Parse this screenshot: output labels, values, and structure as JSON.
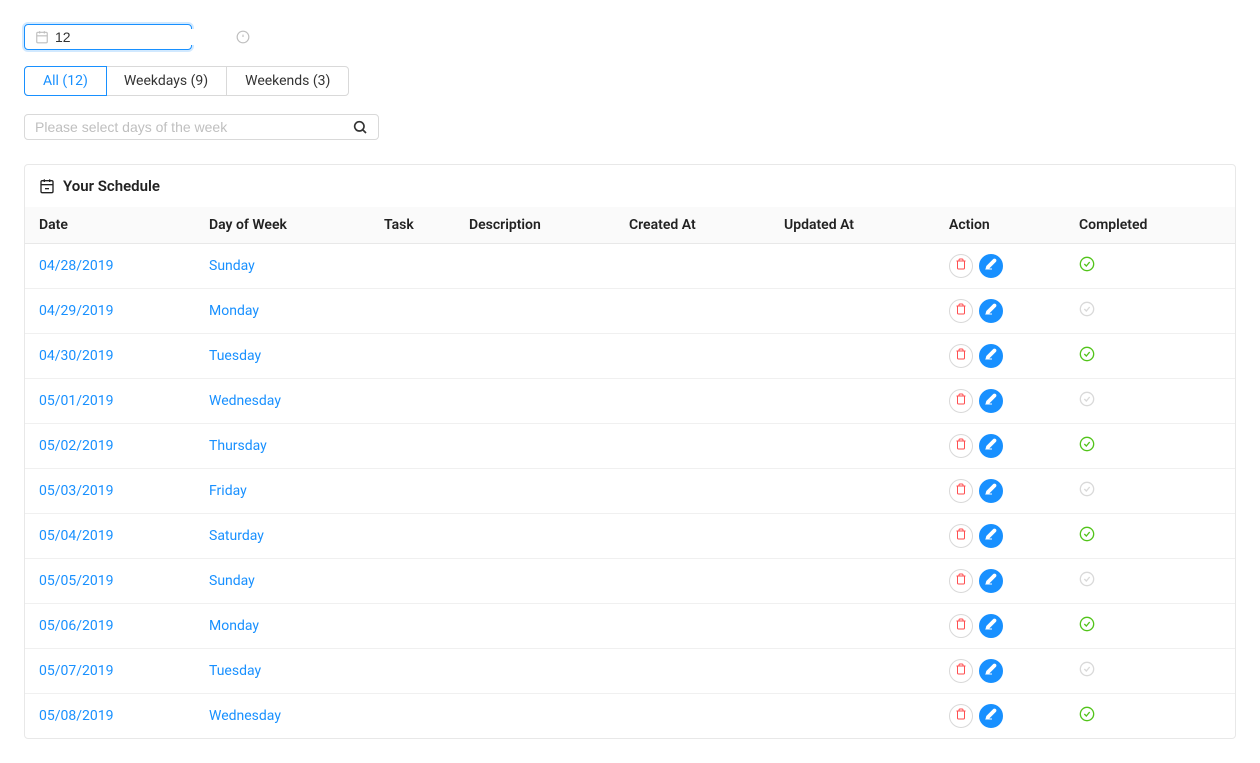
{
  "dateInput": {
    "value": "12"
  },
  "tabs": [
    {
      "label": "All (12)",
      "active": true
    },
    {
      "label": "Weekdays (9)",
      "active": false
    },
    {
      "label": "Weekends (3)",
      "active": false
    }
  ],
  "search": {
    "placeholder": "Please select days of the week",
    "value": ""
  },
  "panel": {
    "title": "Your Schedule"
  },
  "columns": {
    "date": "Date",
    "dow": "Day of Week",
    "task": "Task",
    "desc": "Description",
    "created": "Created At",
    "updated": "Updated At",
    "action": "Action",
    "completed": "Completed"
  },
  "rows": [
    {
      "date": "04/28/2019",
      "dow": "Sunday",
      "task": "",
      "desc": "",
      "created": "",
      "updated": "",
      "completed": true
    },
    {
      "date": "04/29/2019",
      "dow": "Monday",
      "task": "",
      "desc": "",
      "created": "",
      "updated": "",
      "completed": false
    },
    {
      "date": "04/30/2019",
      "dow": "Tuesday",
      "task": "",
      "desc": "",
      "created": "",
      "updated": "",
      "completed": true
    },
    {
      "date": "05/01/2019",
      "dow": "Wednesday",
      "task": "",
      "desc": "",
      "created": "",
      "updated": "",
      "completed": false
    },
    {
      "date": "05/02/2019",
      "dow": "Thursday",
      "task": "",
      "desc": "",
      "created": "",
      "updated": "",
      "completed": true
    },
    {
      "date": "05/03/2019",
      "dow": "Friday",
      "task": "",
      "desc": "",
      "created": "",
      "updated": "",
      "completed": false
    },
    {
      "date": "05/04/2019",
      "dow": "Saturday",
      "task": "",
      "desc": "",
      "created": "",
      "updated": "",
      "completed": true
    },
    {
      "date": "05/05/2019",
      "dow": "Sunday",
      "task": "",
      "desc": "",
      "created": "",
      "updated": "",
      "completed": false
    },
    {
      "date": "05/06/2019",
      "dow": "Monday",
      "task": "",
      "desc": "",
      "created": "",
      "updated": "",
      "completed": true
    },
    {
      "date": "05/07/2019",
      "dow": "Tuesday",
      "task": "",
      "desc": "",
      "created": "",
      "updated": "",
      "completed": false
    },
    {
      "date": "05/08/2019",
      "dow": "Wednesday",
      "task": "",
      "desc": "",
      "created": "",
      "updated": "",
      "completed": true
    }
  ]
}
